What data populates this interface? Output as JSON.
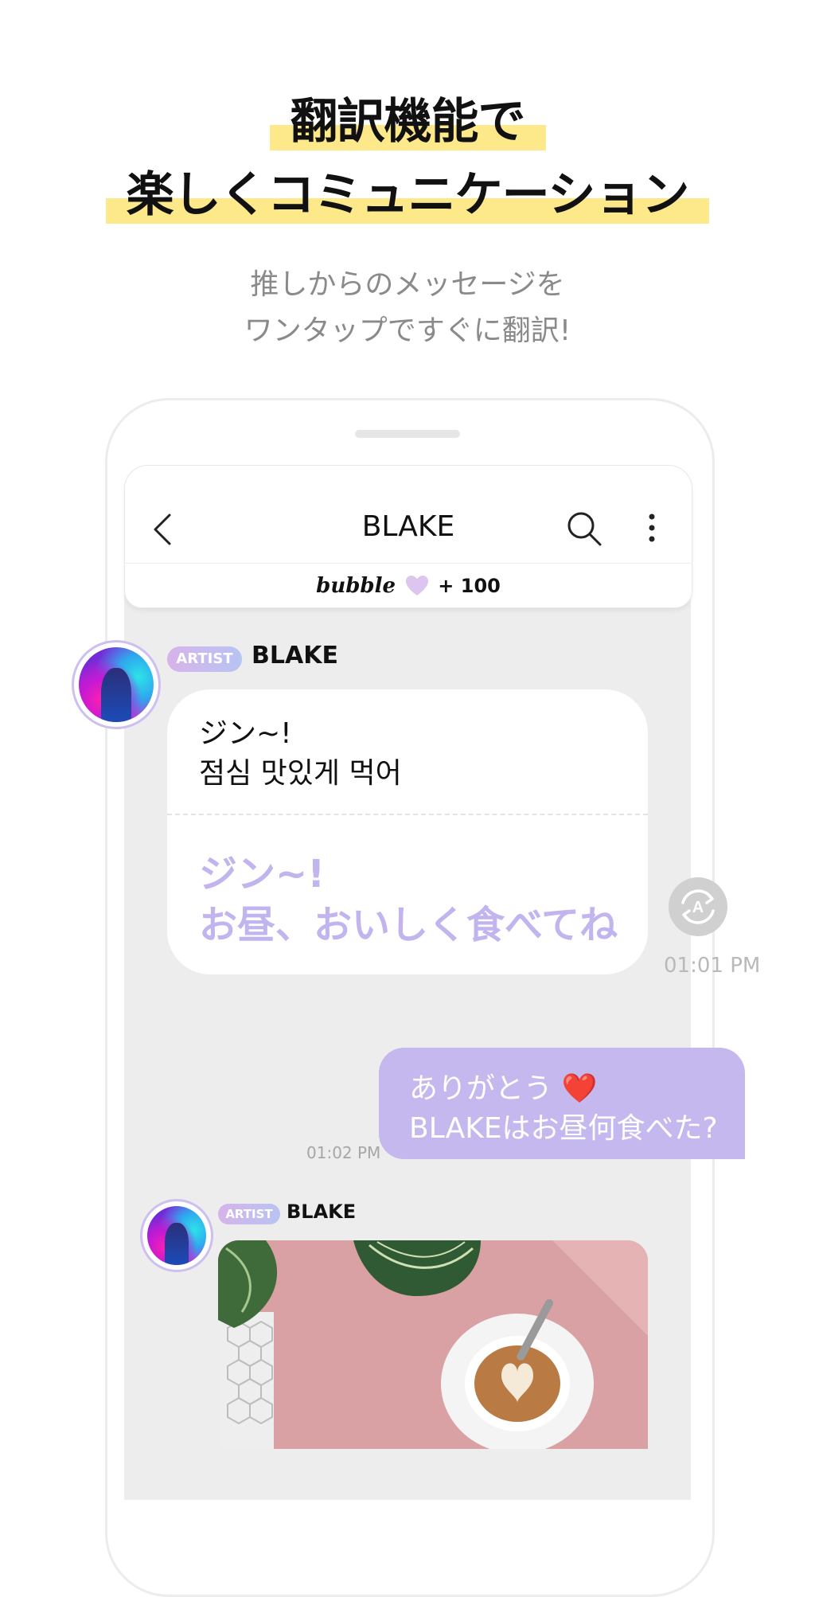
{
  "headline": {
    "line1": "翻訳機能で",
    "line2": "楽しくコミュニケーション",
    "highlight_color": "#fde98a"
  },
  "subheadline": {
    "line1": "推しからのメッセージを",
    "line2": "ワンタップですぐに翻訳!"
  },
  "appbar": {
    "title": "BLAKE",
    "back_icon": "chevron-left-icon",
    "search_icon": "search-icon",
    "more_icon": "more-vertical-icon",
    "bubble_logo": "bubble",
    "bubble_count": "+ 100"
  },
  "chat": {
    "message1": {
      "badge": "ARTIST",
      "sender": "BLAKE",
      "original_line1": "ジン~!",
      "original_line2": "점심 맛있게 먹어",
      "translated_line1": "ジン~!",
      "translated_line2": "お昼、おいしく食べてね",
      "time": "01:01 PM"
    },
    "reply": {
      "line1": "ありがとう ❤️",
      "line2": "BLAKEはお昼何食べた?",
      "time": "01:02 PM"
    },
    "message2": {
      "badge": "ARTIST",
      "sender": "BLAKE"
    }
  },
  "colors": {
    "translated_text": "#c2b4ee",
    "my_bubble": "#c4b8ee",
    "background": "#ededed"
  }
}
